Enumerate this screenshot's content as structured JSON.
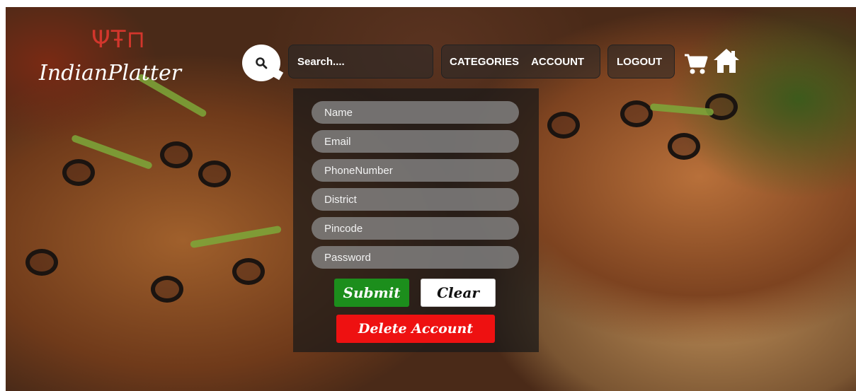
{
  "brand": {
    "name": "IndianPlatter",
    "icon": "platter-logo-icon",
    "accent": "#d2362c"
  },
  "header": {
    "search": {
      "placeholder": "Search....",
      "icon": "search-icon"
    },
    "nav": [
      {
        "label": "CATEGORIES"
      },
      {
        "label": "ACCOUNT"
      },
      {
        "label": "LOGOUT"
      }
    ],
    "cart_icon": "cart-icon",
    "home_icon": "home-icon"
  },
  "form": {
    "fields": [
      {
        "placeholder": "Name",
        "value": ""
      },
      {
        "placeholder": "Email",
        "value": ""
      },
      {
        "placeholder": "PhoneNumber",
        "value": ""
      },
      {
        "placeholder": "District",
        "value": ""
      },
      {
        "placeholder": "Pincode",
        "value": ""
      },
      {
        "placeholder": "Password",
        "value": ""
      }
    ],
    "submit_label": "Submit",
    "clear_label": "Clear",
    "delete_label": "Delete Account",
    "colors": {
      "submit": "#1c8e1c",
      "clear": "#ffffff",
      "delete": "#ee1111"
    }
  }
}
